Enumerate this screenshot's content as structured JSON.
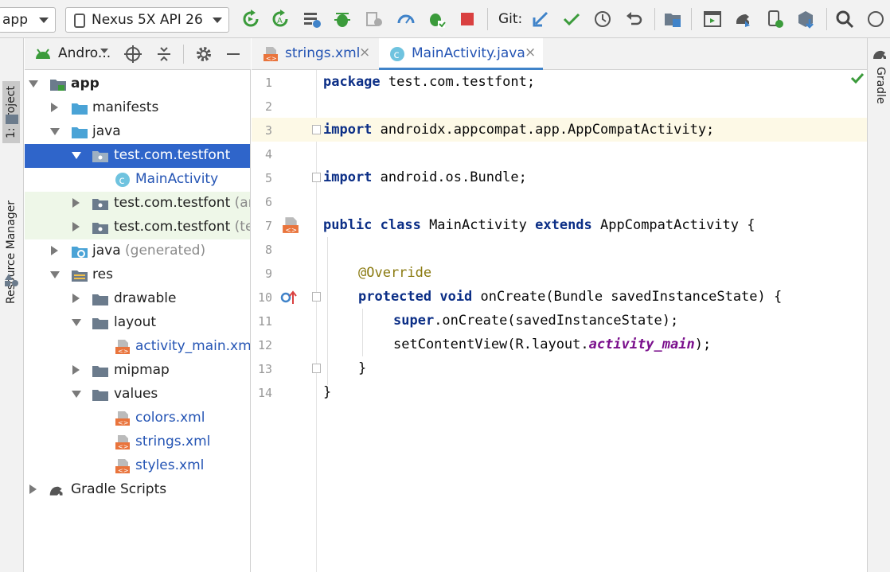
{
  "toolbar": {
    "config_combo": "app",
    "device_combo": "Nexus 5X API 26",
    "git_label": "Git:",
    "icons": [
      "refresh-icon",
      "apply-changes-icon",
      "sync-icon",
      "debug-icon",
      "profile-icon",
      "speedometer-icon",
      "attach-debugger-icon",
      "stop-icon",
      "git-update-icon",
      "git-commit-icon",
      "history-icon",
      "revert-icon",
      "project-structure-icon",
      "avd-manager-icon",
      "sdk-manager-icon",
      "device-file-icon",
      "search-icon"
    ]
  },
  "left_strip": {
    "project_tab": "1: Project",
    "resource_manager_tab": "Resource Manager"
  },
  "right_strip": {
    "gradle_tab": "Gradle"
  },
  "project_panel": {
    "view_title": "Andro...",
    "tree": [
      {
        "label": "app"
      },
      {
        "label": "manifests"
      },
      {
        "label": "java"
      },
      {
        "label": "test.com.testfont"
      },
      {
        "label": "MainActivity"
      },
      {
        "label": "test.com.testfont",
        "suffix": "(and"
      },
      {
        "label": "test.com.testfont",
        "suffix": "(test"
      },
      {
        "label": "java",
        "suffix": "(generated)"
      },
      {
        "label": "res"
      },
      {
        "label": "drawable"
      },
      {
        "label": "layout"
      },
      {
        "label": "activity_main.xml"
      },
      {
        "label": "mipmap"
      },
      {
        "label": "values"
      },
      {
        "label": "colors.xml"
      },
      {
        "label": "strings.xml"
      },
      {
        "label": "styles.xml"
      },
      {
        "label": "Gradle Scripts"
      }
    ]
  },
  "tabs": [
    {
      "label": "strings.xml",
      "active": false
    },
    {
      "label": "MainActivity.java",
      "active": true
    }
  ],
  "editor": {
    "line_numbers": [
      "1",
      "2",
      "3",
      "4",
      "5",
      "6",
      "7",
      "8",
      "9",
      "10",
      "11",
      "12",
      "13",
      "14"
    ],
    "code": {
      "l1_kw": "package",
      "l1_rest": " test.com.testfont;",
      "l3_kw": "import",
      "l3_rest": " androidx.appcompat.app.AppCompatActivity;",
      "l5_kw": "import",
      "l5_rest": " android.os.Bundle;",
      "l7_kw1": "public class",
      "l7_mid": " MainActivity ",
      "l7_kw2": "extends",
      "l7_rest": " AppCompatActivity {",
      "l9_ann": "@Override",
      "l10_kw": "protected void",
      "l10_rest": " onCreate(Bundle savedInstanceState) {",
      "l11_kw": "super",
      "l11_rest": ".onCreate(savedInstanceState);",
      "l12_pre": "setContentView(R.layout.",
      "l12_fld": "activity_main",
      "l12_post": ");",
      "l13": "}",
      "l14": "}"
    }
  }
}
